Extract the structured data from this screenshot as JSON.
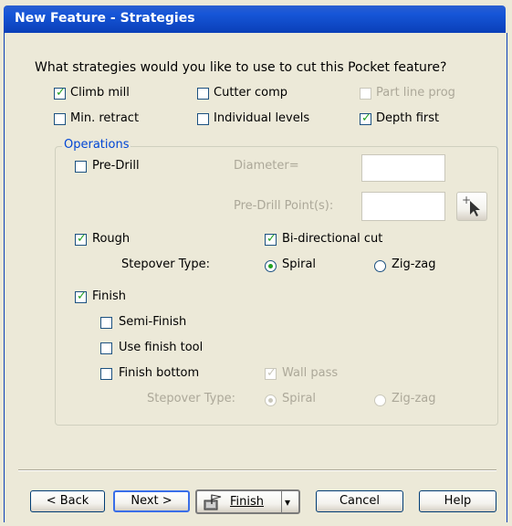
{
  "window": {
    "title": "New Feature - Strategies"
  },
  "prompt": "What strategies would you like to use to cut this Pocket feature?",
  "options": {
    "climb_mill": {
      "label": "Climb mill",
      "checked": true
    },
    "cutter_comp": {
      "label": "Cutter comp",
      "checked": false
    },
    "part_line_prog": {
      "label": "Part line prog",
      "checked": false,
      "disabled": true
    },
    "min_retract": {
      "label": "Min. retract",
      "checked": false
    },
    "individual_levels": {
      "label": "Individual levels",
      "checked": false
    },
    "depth_first": {
      "label": "Depth first",
      "checked": true
    }
  },
  "operations": {
    "group_title": "Operations",
    "pre_drill": {
      "label": "Pre-Drill",
      "checked": false
    },
    "diameter_label": "Diameter=",
    "diameter_value": "",
    "pre_drill_points_label": "Pre-Drill Point(s):",
    "pre_drill_points_value": "",
    "rough": {
      "label": "Rough",
      "checked": true
    },
    "bidirectional": {
      "label": "Bi-directional cut",
      "checked": true
    },
    "rough_stepover_label": "Stepover Type:",
    "rough_spiral": {
      "label": "Spiral",
      "selected": true
    },
    "rough_zigzag": {
      "label": "Zig-zag",
      "selected": false
    },
    "finish": {
      "label": "Finish",
      "checked": true
    },
    "semi_finish": {
      "label": "Semi-Finish",
      "checked": false
    },
    "use_finish_tool": {
      "label": "Use finish tool",
      "checked": false
    },
    "finish_bottom": {
      "label": "Finish bottom",
      "checked": false
    },
    "wall_pass": {
      "label": "Wall pass",
      "checked": true,
      "disabled": true
    },
    "finish_stepover_label": "Stepover Type:",
    "finish_spiral": {
      "label": "Spiral",
      "selected": true,
      "disabled": true
    },
    "finish_zigzag": {
      "label": "Zig-zag",
      "selected": false,
      "disabled": true
    }
  },
  "buttons": {
    "back": "< Back",
    "next": "Next >",
    "finish": "Finish",
    "cancel": "Cancel",
    "help": "Help"
  },
  "icons": {
    "check": "✓",
    "pick_point": "pick-point-icon",
    "finish_flag": "finish-flag-icon",
    "dropdown": "▾"
  }
}
